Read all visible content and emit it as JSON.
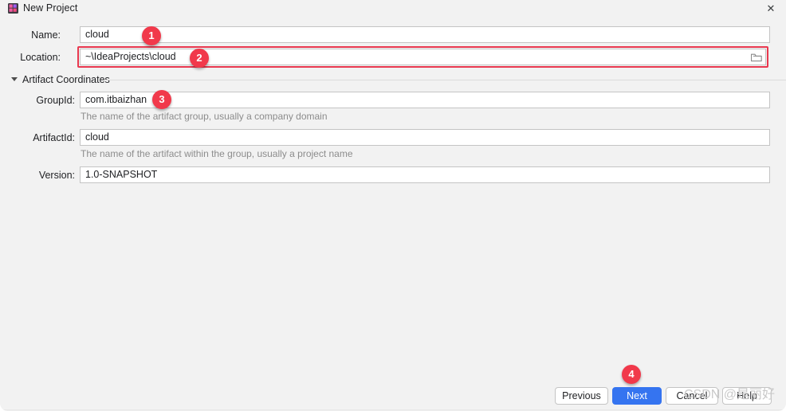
{
  "window": {
    "title": "New Project",
    "icon": "intellij-project-icon",
    "close_label": "✕",
    "accent_primary": "#3574f0",
    "highlight_color": "#e8384f",
    "badge_color": "#f1394b"
  },
  "form": {
    "fields": [
      {
        "id": "name",
        "label": "Name:",
        "value": "cloud",
        "placeholder": "",
        "hint": ""
      },
      {
        "id": "location",
        "label": "Location:",
        "value": "~\\IdeaProjects\\cloud",
        "placeholder": "",
        "hint": "",
        "browse_icon": "folder-icon"
      },
      {
        "id": "groupid",
        "label": "GroupId:",
        "value": "com.itbaizhan",
        "placeholder": "",
        "hint": "The name of the artifact group, usually a company domain"
      },
      {
        "id": "artifactid",
        "label": "ArtifactId:",
        "value": "cloud",
        "placeholder": "",
        "hint": "The name of the artifact within the group, usually a project name"
      },
      {
        "id": "version",
        "label": "Version:",
        "value": "1.0-SNAPSHOT",
        "placeholder": "",
        "hint": ""
      }
    ],
    "section": {
      "title": "Artifact Coordinates",
      "expanded": true,
      "toggle_icon": "chevron-down-icon"
    }
  },
  "footer": {
    "buttons": [
      {
        "id": "previous",
        "label": "Previous",
        "primary": false
      },
      {
        "id": "next",
        "label": "Next",
        "primary": true
      },
      {
        "id": "cancel",
        "label": "Cancel",
        "primary": false
      },
      {
        "id": "help",
        "label": "Help",
        "primary": false
      }
    ]
  },
  "annotations": [
    {
      "id": "1",
      "label": "1"
    },
    {
      "id": "2",
      "label": "2"
    },
    {
      "id": "3",
      "label": "3"
    },
    {
      "id": "4",
      "label": "4"
    }
  ],
  "watermark": {
    "prefix": "CSDN @",
    "suffix": "是丽好"
  }
}
